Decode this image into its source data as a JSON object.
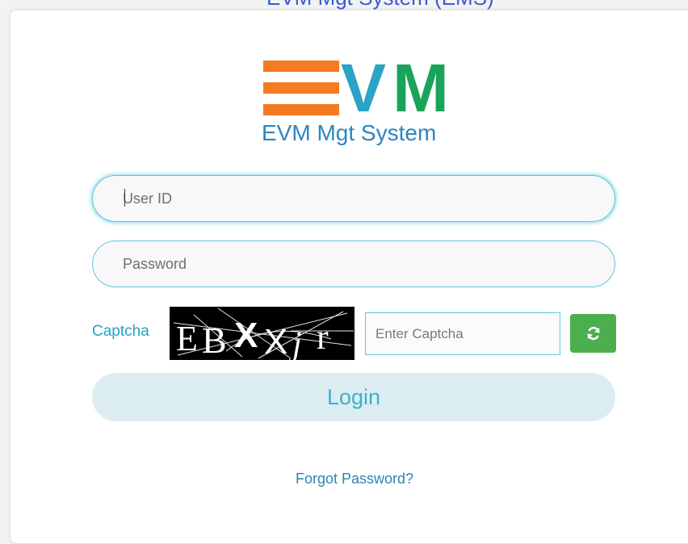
{
  "header": {
    "cut_title": "EVM Mgt System (EMS)"
  },
  "logo": {
    "letter_v": "V",
    "letter_m": "M",
    "subtitle": "EVM Mgt System",
    "colors": {
      "bars": "#f47b20",
      "v": "#2aa3c7",
      "m": "#1aa35a",
      "subtitle": "#2d86c0"
    }
  },
  "login_form": {
    "user_id": {
      "value": "",
      "placeholder": "User ID"
    },
    "password": {
      "value": "",
      "placeholder": "Password"
    },
    "captcha_label": "Captcha",
    "captcha_image_text": "EBXXjr",
    "captcha_input": {
      "value": "",
      "placeholder": "Enter Captcha"
    },
    "refresh_icon": "refresh-icon",
    "login_label": "Login",
    "forgot_password": "Forgot Password?"
  },
  "colors": {
    "accent": "#5ec6dd",
    "login_bg": "#dcedf2",
    "login_text": "#3ab0cf",
    "refresh_button": "#4cae4c",
    "link": "#2a86b0"
  }
}
